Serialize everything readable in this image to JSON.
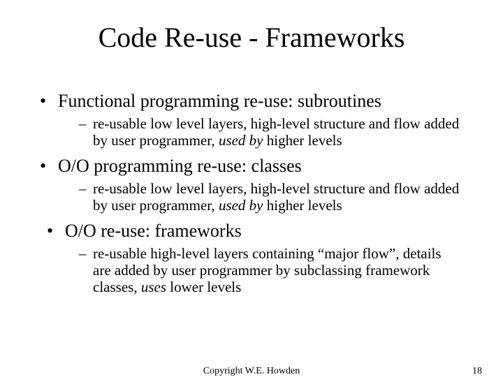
{
  "title": "Code Re-use - Frameworks",
  "bullets": {
    "b1": {
      "text": "Functional programming re-use: subroutines",
      "sub_pre": "re-usable low level layers, high-level structure and flow added by user programmer, ",
      "sub_em": "used by",
      "sub_post": " higher levels"
    },
    "b2": {
      "text": "O/O programming re-use: classes",
      "sub_pre": "re-usable low level layers, high-level structure and flow added by user programmer, ",
      "sub_em": "used by",
      "sub_post": " higher levels"
    },
    "b3": {
      "text": "O/O re-use: frameworks",
      "sub_pre": "re-usable high-level layers containing “major flow”, details are added by user programmer by subclassing framework classes, ",
      "sub_em": "uses",
      "sub_post": " lower levels"
    }
  },
  "footer": {
    "copyright": "Copyright W.E. Howden",
    "page": "18"
  }
}
